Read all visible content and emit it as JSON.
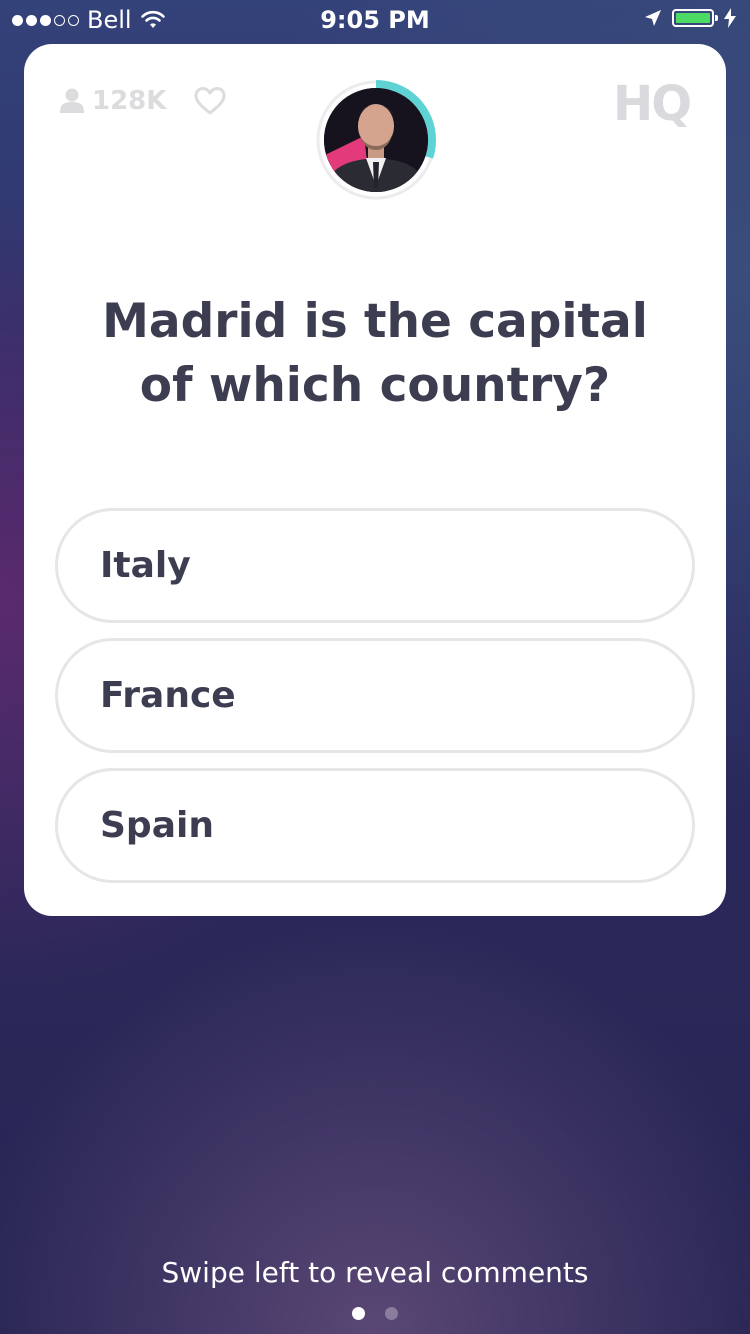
{
  "status_bar": {
    "carrier": "Bell",
    "time": "9:05 PM",
    "signal_full": 3,
    "signal_total": 5
  },
  "header": {
    "viewer_count": "128K",
    "logo": "HQ",
    "host_timer_progress": 0.3
  },
  "question": {
    "text": "Madrid is the capital of which country?"
  },
  "answers": [
    {
      "label": "Italy"
    },
    {
      "label": "France"
    },
    {
      "label": "Spain"
    }
  ],
  "footer": {
    "hint": "Swipe left to reveal comments",
    "page_count": 2,
    "active_page": 0
  },
  "colors": {
    "timer_ring": "#5fd3d3",
    "text_dark": "#3d3d52",
    "muted": "#dcdcdf",
    "battery": "#4cd964"
  },
  "icons": [
    "wifi-icon",
    "location-arrow-icon",
    "battery-icon",
    "charging-bolt-icon",
    "user-icon",
    "heart-icon"
  ]
}
